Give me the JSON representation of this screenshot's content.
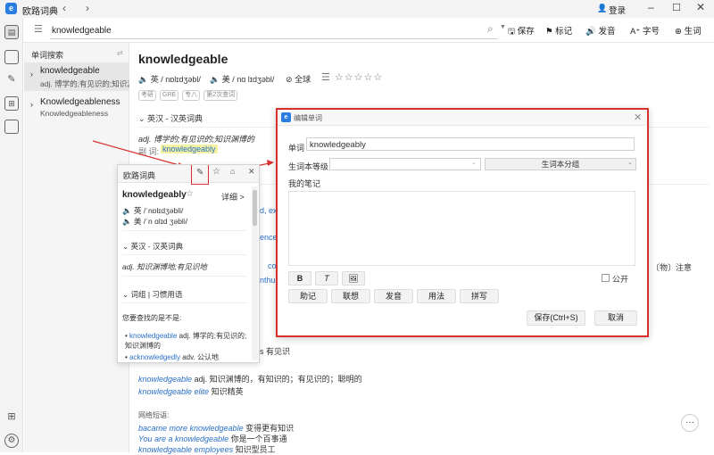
{
  "app": {
    "title": "欧路词典",
    "login": "登录",
    "logo": "e"
  },
  "search": {
    "value": "knowledgeable",
    "toolbar": [
      "保存",
      "标记",
      "发音",
      "字号",
      "生词"
    ]
  },
  "sidebar": {
    "header": "单词搜索",
    "items": [
      {
        "word": "knowledgeable",
        "def": "adj. 博学的;有见识的;知识渊博的"
      },
      {
        "word": "Knowledgeableness",
        "def": "Knowledgeableness"
      }
    ]
  },
  "entry": {
    "headword": "knowledgeable",
    "pron_uk": "英 / nɒlɪdʒəbl/",
    "pron_us": "美 / nɑ lɪdʒəbl/",
    "globe": "全球",
    "tags": [
      "考研",
      "GRE",
      "专八",
      "第2次查词"
    ],
    "section1": "英汉 - 汉英词典",
    "def": "adj. 博学的;有见识的;知识渊博的",
    "derived_label": "副 词:",
    "derived": "knowledgeably",
    "fragments": {
      "f1": "d, exp",
      "f2": "ence",
      "f3": "co",
      "f4": "nthus",
      "f5": "〔物〕注意",
      "f6": "s 有见识"
    },
    "phrases": [
      {
        "en": "knowledgeable",
        "zh": "adj. 知识渊博的，有知识的；有见识的；聪明的"
      },
      {
        "en": "knowledgeable elite",
        "zh": "知识精英"
      }
    ],
    "web_label": "网络短语:",
    "web": [
      {
        "en": "bacame more knowledgeable",
        "zh": "变得更有知识"
      },
      {
        "en": "You are a knowledgeable",
        "zh": "你是一个百事通"
      },
      {
        "en": "knowledgeable employees",
        "zh": "知识型员工"
      }
    ]
  },
  "popup": {
    "title": "欧路词典",
    "word": "knowledgeably",
    "detail": "详细 >",
    "pron_uk": "英 /ˈnɒlɪdʒəbli/",
    "pron_us": "美 /ˈn ɑlɪd ʒəbli/",
    "section": "英汉 - 汉英词典",
    "def": "adj. 知识渊博地;有见识地",
    "section2": "词组 | 习惯用语",
    "hint": "您要查找的是不是:",
    "suggestions": [
      {
        "en": "knowledgeable",
        "zh": "adj. 博学的;有见识的;知识渊博的"
      },
      {
        "en": "acknowledgedly",
        "zh": "adv. 公认地"
      }
    ]
  },
  "dialog": {
    "title": "编辑单词",
    "word_label": "单词",
    "word_value": "knowledgeably",
    "level_label": "生词本等级",
    "group_placeholder": "生词本分组",
    "notes_label": "我的笔记",
    "format": [
      "B",
      "T"
    ],
    "public": "公开",
    "tabs": [
      "助记",
      "联想",
      "发音",
      "用法",
      "拼写"
    ],
    "save": "保存(Ctrl+S)",
    "cancel": "取消"
  },
  "colors": {
    "accent": "#2a7de1",
    "highlight": "#d9302e",
    "link": "#2a6fc7"
  }
}
